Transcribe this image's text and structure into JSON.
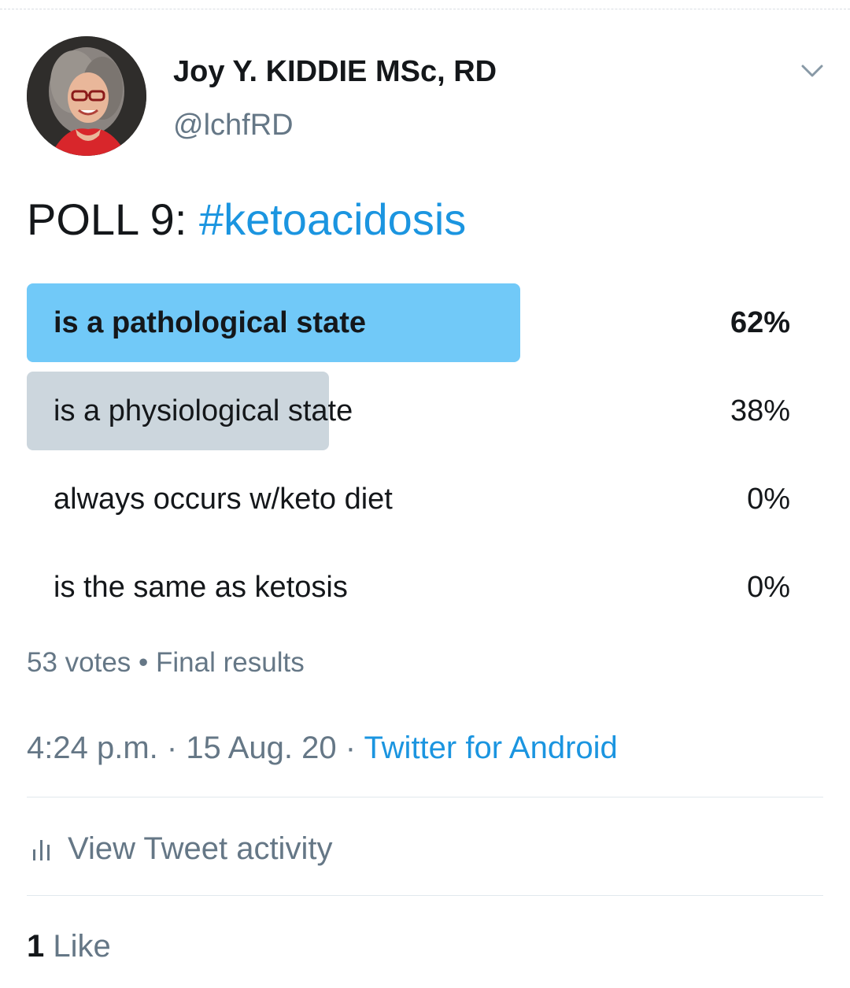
{
  "author": {
    "display_name": "Joy Y. KIDDIE MSc, RD",
    "handle": "@lchfRD",
    "avatar_icon": "profile-photo"
  },
  "header": {
    "menu_icon": "chevron-down-icon"
  },
  "tweet": {
    "text_prefix": "POLL 9: ",
    "hashtag": "#ketoacidosis"
  },
  "poll": {
    "options": [
      {
        "label": "is a pathological state",
        "percent_label": "62%",
        "percent": 62,
        "winner": true
      },
      {
        "label": "is a physiological state",
        "percent_label": "38%",
        "percent": 38,
        "winner": false
      },
      {
        "label": "always occurs w/keto diet",
        "percent_label": "0%",
        "percent": 0,
        "winner": false
      },
      {
        "label": "is the same as ketosis",
        "percent_label": "0%",
        "percent": 0,
        "winner": false
      }
    ],
    "votes": "53 votes",
    "separator": " • ",
    "status": "Final results"
  },
  "meta": {
    "time": "4:24 p.m.",
    "date": "15 Aug. 20",
    "separator": " · ",
    "source": "Twitter for Android"
  },
  "activity": {
    "label": "View Tweet activity",
    "icon": "bar-chart-icon"
  },
  "engagement": {
    "likes_count": "1",
    "likes_label": "Like"
  },
  "colors": {
    "accent": "#1b95e0",
    "winner_bar": "#71c9f8",
    "loser_bar": "#ccd6dd",
    "muted_text": "#657786"
  }
}
